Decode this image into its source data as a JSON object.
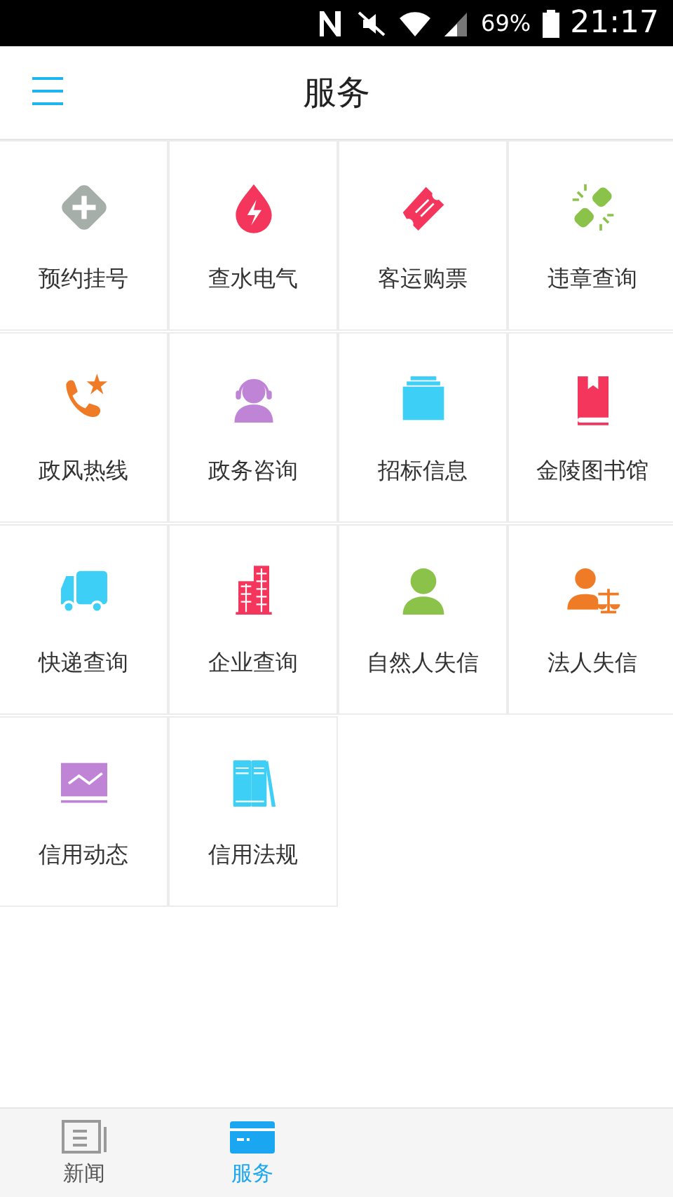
{
  "status_bar": {
    "battery": "69%",
    "time": "21:17"
  },
  "header": {
    "title": "服务"
  },
  "services": [
    {
      "label": "预约挂号",
      "kind": "plus",
      "color": "#a5aea9"
    },
    {
      "label": "查水电气",
      "kind": "drop",
      "color": "#f5365c"
    },
    {
      "label": "客运购票",
      "kind": "ticket",
      "color": "#f5365c"
    },
    {
      "label": "违章查询",
      "kind": "link",
      "color": "#8bc34a"
    },
    {
      "label": "政风热线",
      "kind": "phone",
      "color": "#f07b26"
    },
    {
      "label": "政务咨询",
      "kind": "agent",
      "color": "#bf84d6"
    },
    {
      "label": "招标信息",
      "kind": "folder",
      "color": "#3ecff7"
    },
    {
      "label": "金陵图书馆",
      "kind": "book",
      "color": "#f5365c"
    },
    {
      "label": "快递查询",
      "kind": "truck",
      "color": "#3ecff7"
    },
    {
      "label": "企业查询",
      "kind": "building",
      "color": "#f5365c"
    },
    {
      "label": "自然人失信",
      "kind": "person",
      "color": "#8bc34a"
    },
    {
      "label": "法人失信",
      "kind": "scale",
      "color": "#f07b26"
    },
    {
      "label": "信用动态",
      "kind": "chart",
      "color": "#bf84d6"
    },
    {
      "label": "信用法规",
      "kind": "books",
      "color": "#3ecff7"
    }
  ],
  "tab_bar": [
    {
      "label": "新闻",
      "kind": "news",
      "selected": false
    },
    {
      "label": "服务",
      "kind": "card",
      "selected": true
    }
  ]
}
